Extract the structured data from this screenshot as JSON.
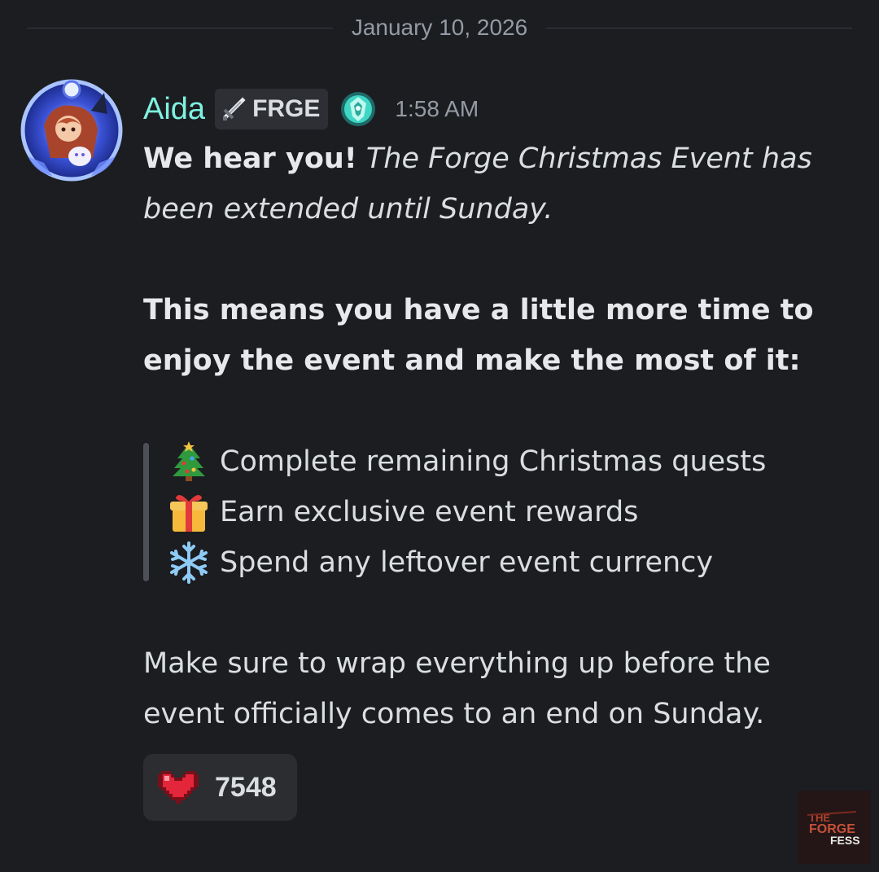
{
  "date_divider": "January 10, 2026",
  "message": {
    "author": "Aida",
    "tag": {
      "icon": "sword-icon",
      "label": "FRGE"
    },
    "role_icon": "teal-crest-icon",
    "timestamp": "1:58 AM",
    "line1_bold": "We hear you!",
    "line1_italic": "The Forge Christmas Event has",
    "line2_italic": "been extended until Sunday.",
    "para2_line1": "This means you have a little more time to",
    "para2_line2": "enjoy the event and make the most of it:",
    "quote_items": [
      {
        "icon": "christmas-tree-icon",
        "text": "Complete remaining Christmas quests"
      },
      {
        "icon": "gift-icon",
        "text": "Earn exclusive event rewards"
      },
      {
        "icon": "snowflake-icon",
        "text": "Spend any leftover event currency"
      }
    ],
    "closing_line1": "Make sure to wrap everything up before the",
    "closing_line2": "event officially comes to an end on Sunday."
  },
  "reaction": {
    "icon": "pixel-heart-icon",
    "count": "7548"
  },
  "watermark": {
    "text": "THE FORGE FESS"
  },
  "colors": {
    "background": "#1c1d21",
    "username": "#7ff2e1",
    "text": "#dbdee1",
    "muted": "#949ba4",
    "quote_bar": "#4e5058"
  }
}
